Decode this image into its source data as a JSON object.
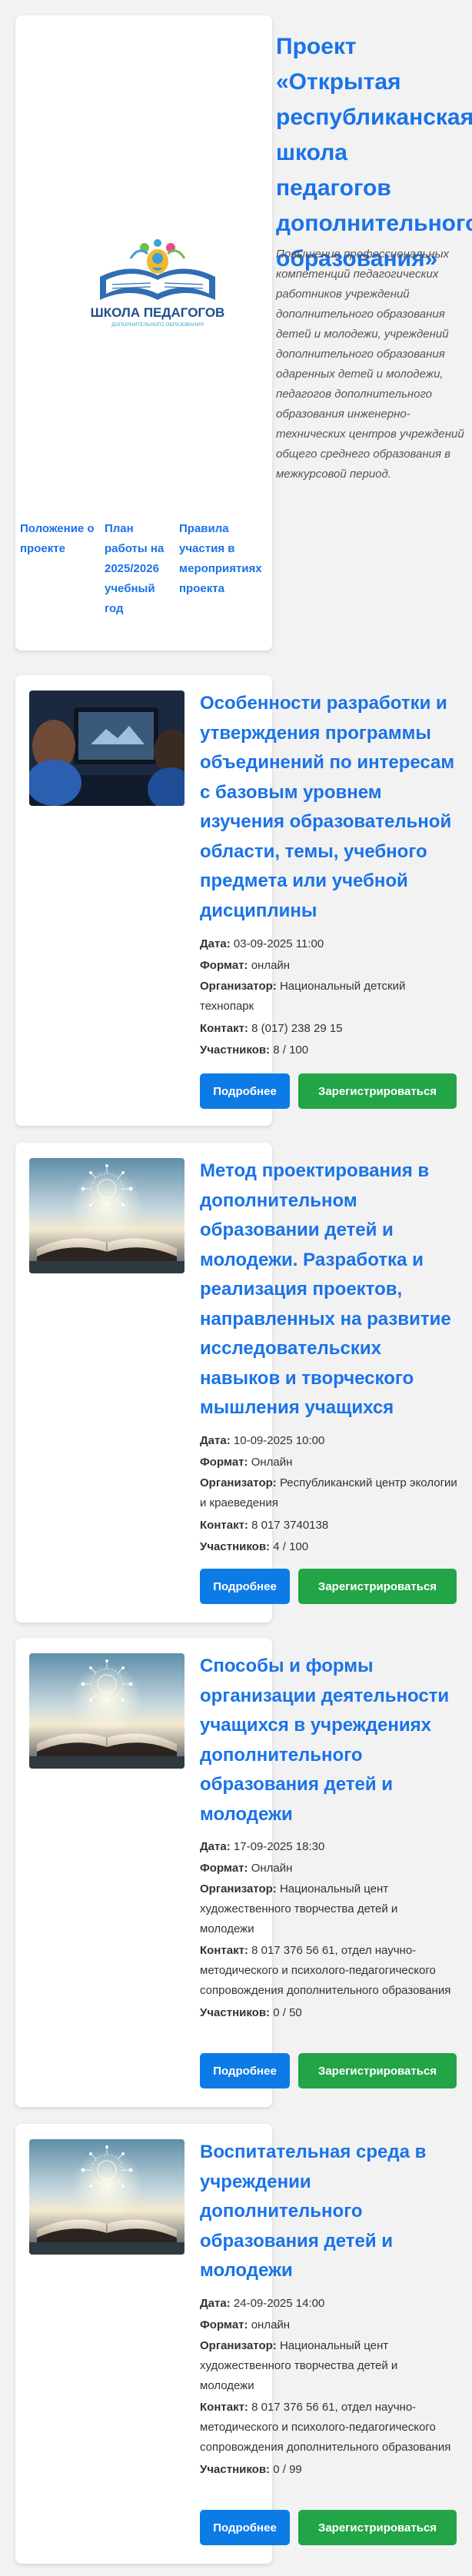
{
  "project": {
    "title": "Проект «Открытая республиканская школа педагогов дополнительного образования»",
    "description": "Повышение профессиональных компетенций педагогических работников учреждений дополнительного образования детей и молодежи, учреждений дополнительного образования одаренных детей и молодежи, педагогов дополнительного образования инженерно-технических центров учреждений общего среднего образования в межкурсовой период.",
    "logo_text": "ШКОЛА ПЕДАГОГОВ",
    "logo_subtext": "ДОПОЛНИТЕЛЬНОГО ОБРАЗОВАНИЯ",
    "nav": {
      "link1": "Положение о проекте",
      "link2": "План работы на 2025/2026 учебный год",
      "link3": "Правила участия в мероприятиях проекта"
    }
  },
  "labels": {
    "date": "Дата:",
    "format": "Формат:",
    "organizer": "Организатор:",
    "contact": "Контакт:",
    "participants": "Участников:",
    "more_button": "Подробнее",
    "register_button": "Зарегистрироваться"
  },
  "events": [
    {
      "title": "Особенности разработки и утверждения программы объединений по интересам с базовым уровнем изучения образовательной области, темы, учебного предмета или учебной дисциплины",
      "date": "03-09-2025 11:00",
      "format": "онлайн",
      "organizer": "Национальный детский технопарк",
      "contact": "8 (017) 238 29 15",
      "participants": "8 / 100",
      "image": "classroom-screen-photo"
    },
    {
      "title": "Метод проектирования в дополнительном образовании детей и молодежи. Разработка и реализация проектов, направленных на развитие исследовательских навыков и творческого мышления учащихся",
      "date": "10-09-2025 10:00",
      "format": "Онлайн",
      "organizer": "Республиканский центр экологии и краеведения",
      "contact": "8 017 3740138",
      "participants": "4 / 100",
      "image": "open-book-photo"
    },
    {
      "title": "Способы и формы организации деятельности учащихся в учреждениях дополнительного образования детей и молодежи",
      "date": "17-09-2025 18:30",
      "format": "Онлайн",
      "organizer": "Национальный цент художественного творчества детей и молодежи",
      "contact": "8 017 376 56 61, отдел научно-методического и психолого-педагогического сопровождения дополнительного образования",
      "participants": "0 / 50",
      "image": "open-book-photo"
    },
    {
      "title": "Воспитательная среда в учреждении дополнительного образования детей и молодежи",
      "date": "24-09-2025 14:00",
      "format": "онлайн",
      "organizer": "Национальный цент художественного творчества детей и молодежи",
      "contact": "8 017 376 56 61, отдел научно-методического и психолого-педагогического сопровождения дополнительного образования",
      "participants": "0 / 99",
      "image": "open-book-photo"
    }
  ],
  "colors": {
    "link": "#1a73e8",
    "more_button": "#0d7be6",
    "register_button": "#22a447"
  }
}
